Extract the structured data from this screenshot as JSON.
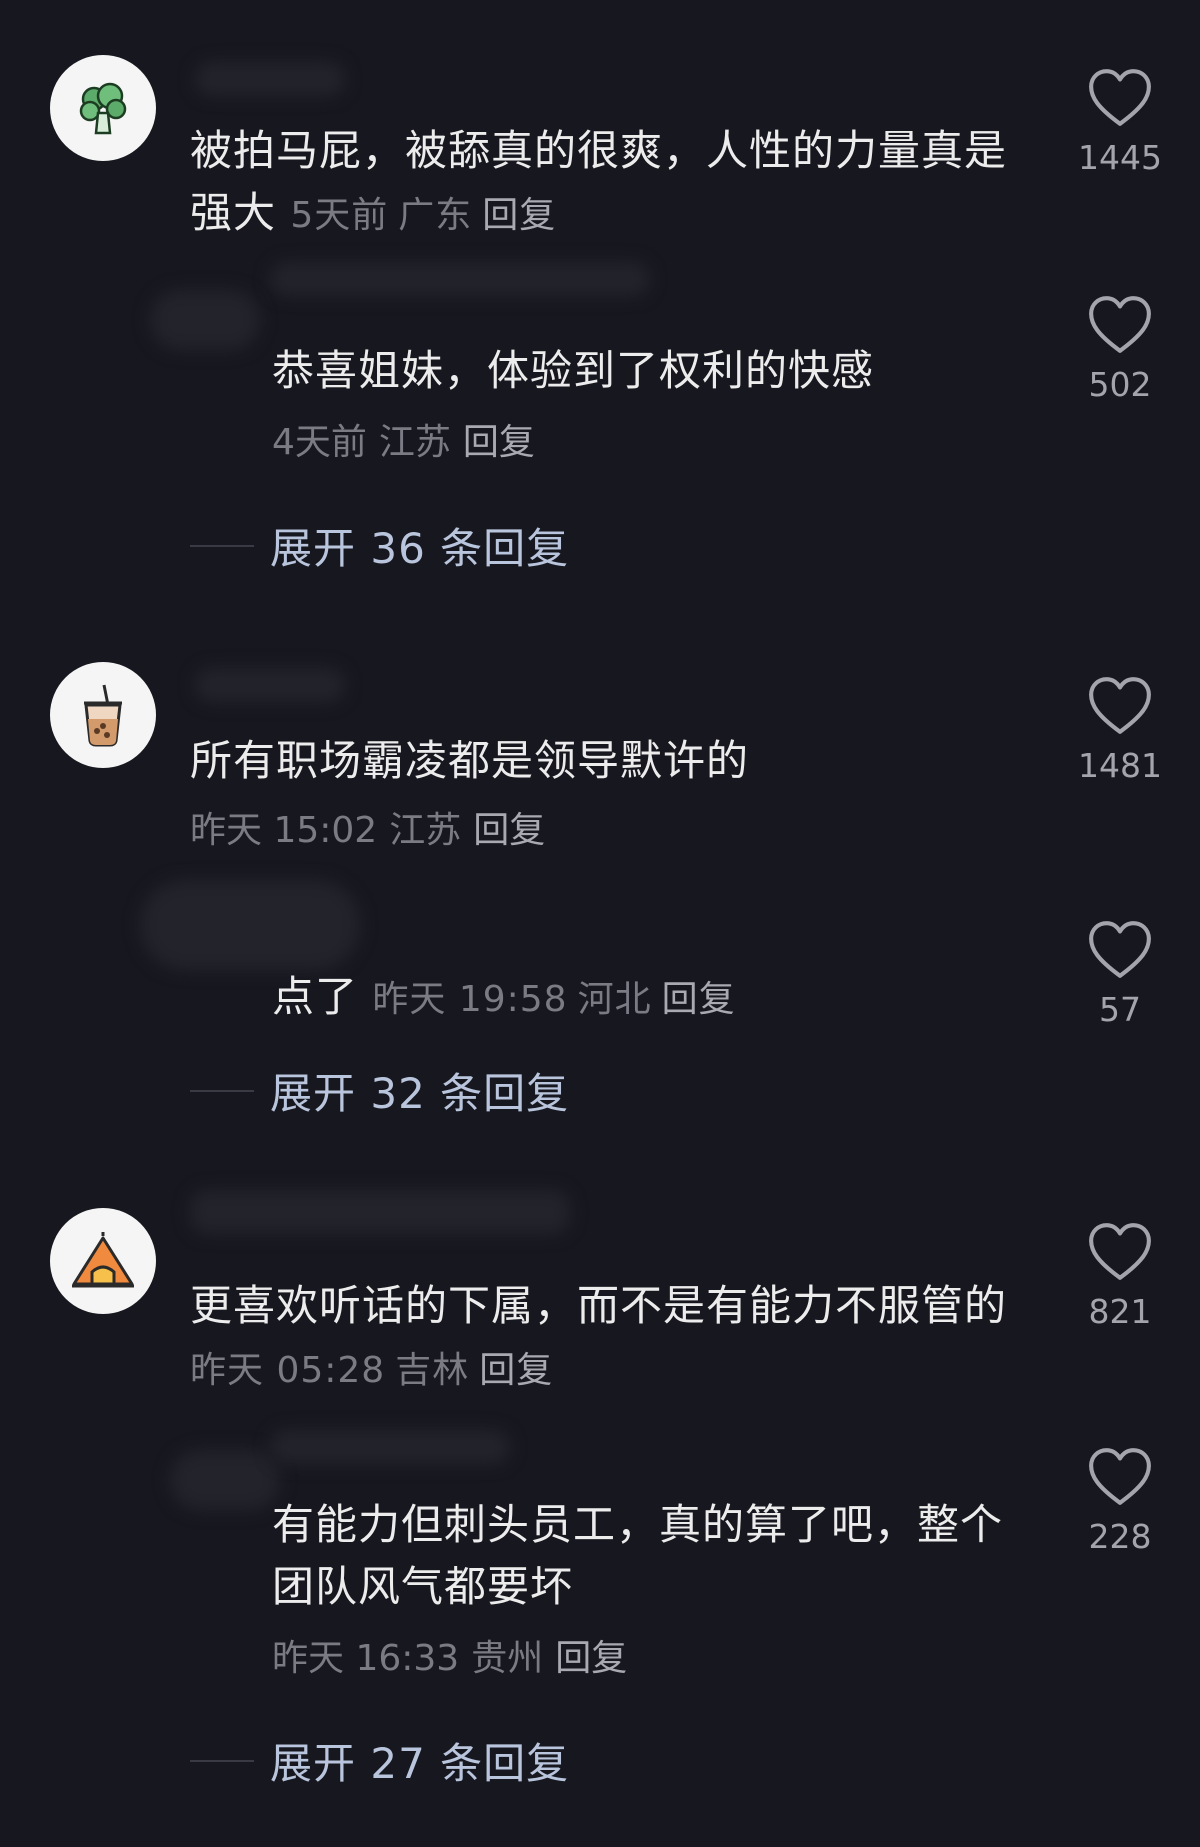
{
  "threads": [
    {
      "comment": {
        "text": "被拍马屁，被舔真的很爽，人性的力量真是强大",
        "time": "5天前",
        "location": "广东",
        "reply_label": "回复",
        "likes": "1445",
        "avatar_icon": "broccoli-icon"
      },
      "reply": {
        "text": "恭喜姐妹，体验到了权利的快感",
        "time": "4天前",
        "location": "江苏",
        "reply_label": "回复",
        "likes": "502"
      },
      "expand_label": "展开 36 条回复"
    },
    {
      "comment": {
        "text": "所有职场霸凌都是领导默许的",
        "time": "昨天 15:02",
        "location": "江苏",
        "reply_label": "回复",
        "likes": "1481",
        "avatar_icon": "bubble-tea-icon"
      },
      "reply": {
        "text": "点了",
        "time": "昨天 19:58",
        "location": "河北",
        "reply_label": "回复",
        "likes": "57"
      },
      "expand_label": "展开 32 条回复"
    },
    {
      "comment": {
        "text": "更喜欢听话的下属，而不是有能力不服管的",
        "time": "昨天 05:28",
        "location": "吉林",
        "reply_label": "回复",
        "likes": "821",
        "avatar_icon": "tent-icon"
      },
      "reply": {
        "text": "有能力但刺头员工，真的算了吧，整个团队风气都要坏",
        "time": "昨天 16:33",
        "location": "贵州",
        "reply_label": "回复",
        "likes": "228"
      },
      "expand_label": "展开 27 条回复"
    }
  ],
  "colors": {
    "background": "#17171f",
    "text": "#ececec",
    "meta": "#7b7b84",
    "expand": "#b9c5dc"
  }
}
